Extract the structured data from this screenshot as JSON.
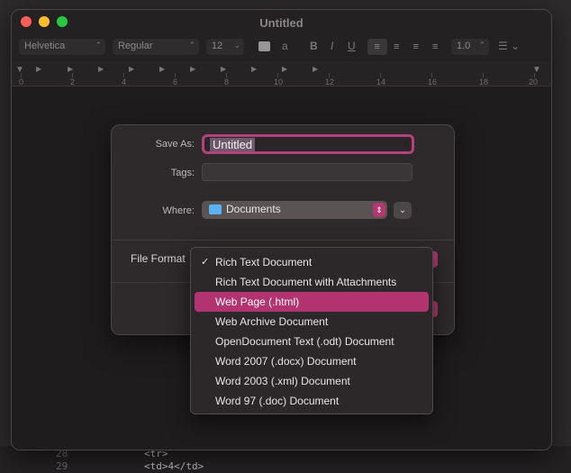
{
  "window": {
    "title": "Untitled"
  },
  "toolbar": {
    "font_family": "Helvetica",
    "font_style": "Regular",
    "font_size": "12",
    "spacing": "1.0"
  },
  "ruler": {
    "ticks": [
      "0",
      "2",
      "4",
      "6",
      "8",
      "10",
      "12",
      "14",
      "16",
      "18",
      "20"
    ]
  },
  "save_dialog": {
    "save_as_label": "Save As:",
    "save_as_value": "Untitled",
    "tags_label": "Tags:",
    "where_label": "Where:",
    "where_value": "Documents",
    "file_format_label": "File Format"
  },
  "format_menu": {
    "items": [
      {
        "label": "Rich Text Document",
        "checked": true
      },
      {
        "label": "Rich Text Document with Attachments"
      },
      {
        "label": "Web Page (.html)",
        "highlighted": true
      },
      {
        "label": "Web Archive Document"
      },
      {
        "label": "OpenDocument Text (.odt) Document"
      },
      {
        "label": "Word 2007 (.docx) Document"
      },
      {
        "label": "Word 2003 (.xml) Document"
      },
      {
        "label": "Word 97 (.doc) Document"
      }
    ],
    "check_glyph": "✓"
  },
  "background_editor": {
    "lines": [
      {
        "num": "28",
        "code": "<tr>"
      },
      {
        "num": "29",
        "code": "    <td>4</td>"
      }
    ]
  },
  "colors": {
    "accent": "#b1336f",
    "folder": "#5ab3f0"
  }
}
